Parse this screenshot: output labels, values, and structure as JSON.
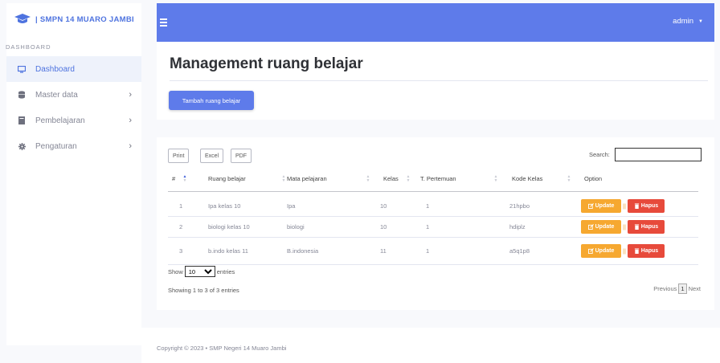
{
  "sidebar": {
    "brand": "| SMPN 14 MUARO JAMBI",
    "section": "DASHBOARD",
    "items": [
      {
        "label": "Dashboard",
        "icon": "desktop-icon",
        "active": true
      },
      {
        "label": "Master data",
        "icon": "database-icon"
      },
      {
        "label": "Pembelajaran",
        "icon": "book-icon"
      },
      {
        "label": "Pengaturan",
        "icon": "gear-icon"
      }
    ]
  },
  "topbar": {
    "user": "admin"
  },
  "main": {
    "title": "Management ruang belajar",
    "add_button": "Tambah ruang belajar"
  },
  "table": {
    "buttons": {
      "print": "Print",
      "excel": "Excel",
      "pdf": "PDF"
    },
    "search_label": "Search:",
    "search_value": "",
    "columns": [
      "#",
      "Ruang belajar",
      "Mata pelajaran",
      "Kelas",
      "T. Pertemuan",
      "Kode Kelas",
      "Option"
    ],
    "rows": [
      {
        "no": "1",
        "ruang": "Ipa kelas 10",
        "mapel": "Ipa",
        "kelas": "10",
        "pertemuan": "1",
        "kode": "21hpbo"
      },
      {
        "no": "2",
        "ruang": "biologi kelas 10",
        "mapel": "biologi",
        "kelas": "10",
        "pertemuan": "1",
        "kode": "hdiplz"
      },
      {
        "no": "3",
        "ruang": "b.indo kelas 11",
        "mapel": "B.indonesia",
        "kelas": "11",
        "pertemuan": "1",
        "kode": "a5q1p8"
      }
    ],
    "update_label": "Update",
    "separator": "||",
    "delete_label": "Hapus",
    "show_prefix": "Show",
    "entries_value": "10",
    "show_suffix": "entries",
    "info": "Showing 1 to 3 of 3 entries",
    "pager": {
      "prev": "Previous",
      "current": "1",
      "next": "Next"
    }
  },
  "footer": "Copyright © 2023  • SMP Negeri 14 Muaro Jambi",
  "colors": {
    "primary": "#5e7bea",
    "warning": "#f6a830",
    "danger": "#e74a3b"
  }
}
